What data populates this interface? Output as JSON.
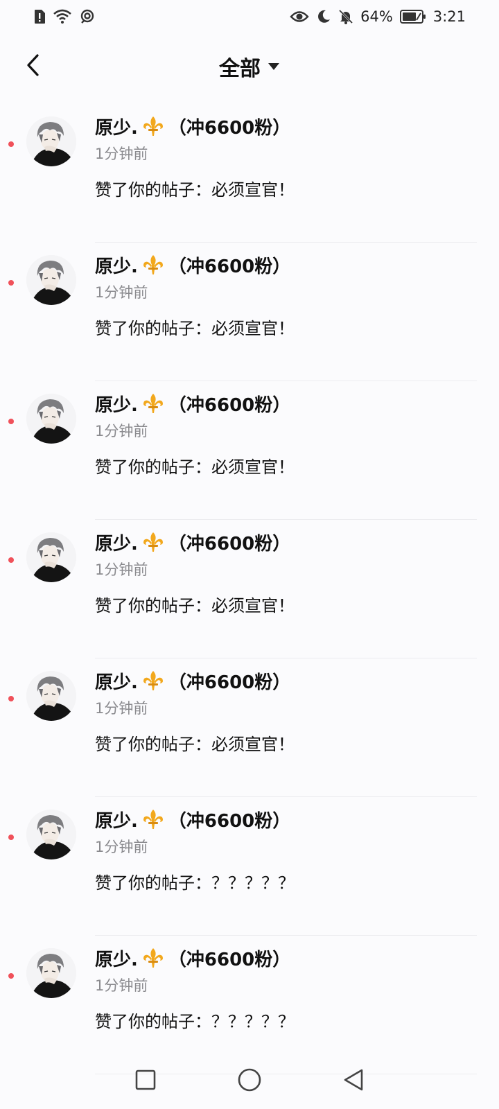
{
  "status_bar": {
    "time": "3:21",
    "battery_percent": "64%",
    "icons_left": [
      "alert-icon",
      "wifi-icon",
      "hotspot-icon"
    ],
    "icons_right": [
      "eye-icon",
      "moon-icon",
      "bell-off-icon",
      "battery-icon"
    ]
  },
  "header": {
    "title": "全部",
    "back_icon": "chevron-left-icon",
    "dropdown_icon": "caret-down-icon"
  },
  "notifications": [
    {
      "name": "原少.",
      "name_suffix": "（冲6600粉）",
      "time": "1分钟前",
      "message": "赞了你的帖子：必须宣官！",
      "unread": true
    },
    {
      "name": "原少.",
      "name_suffix": "（冲6600粉）",
      "time": "1分钟前",
      "message": "赞了你的帖子：必须宣官！",
      "unread": true
    },
    {
      "name": "原少.",
      "name_suffix": "（冲6600粉）",
      "time": "1分钟前",
      "message": "赞了你的帖子：必须宣官！",
      "unread": true
    },
    {
      "name": "原少.",
      "name_suffix": "（冲6600粉）",
      "time": "1分钟前",
      "message": "赞了你的帖子：必须宣官！",
      "unread": true
    },
    {
      "name": "原少.",
      "name_suffix": "（冲6600粉）",
      "time": "1分钟前",
      "message": "赞了你的帖子：必须宣官！",
      "unread": true
    },
    {
      "name": "原少.",
      "name_suffix": "（冲6600粉）",
      "time": "1分钟前",
      "message": "赞了你的帖子：？？？？？",
      "unread": true
    },
    {
      "name": "原少.",
      "name_suffix": "（冲6600粉）",
      "time": "1分钟前",
      "message": "赞了你的帖子：？？？？？",
      "unread": true
    }
  ],
  "nav_bar": {
    "icons": [
      "recents-square-icon",
      "home-circle-icon",
      "back-triangle-icon"
    ]
  },
  "colors": {
    "unread_dot": "#f0515a",
    "fleur_de_lis": "#f2a81d",
    "background": "#fbfbfd"
  }
}
